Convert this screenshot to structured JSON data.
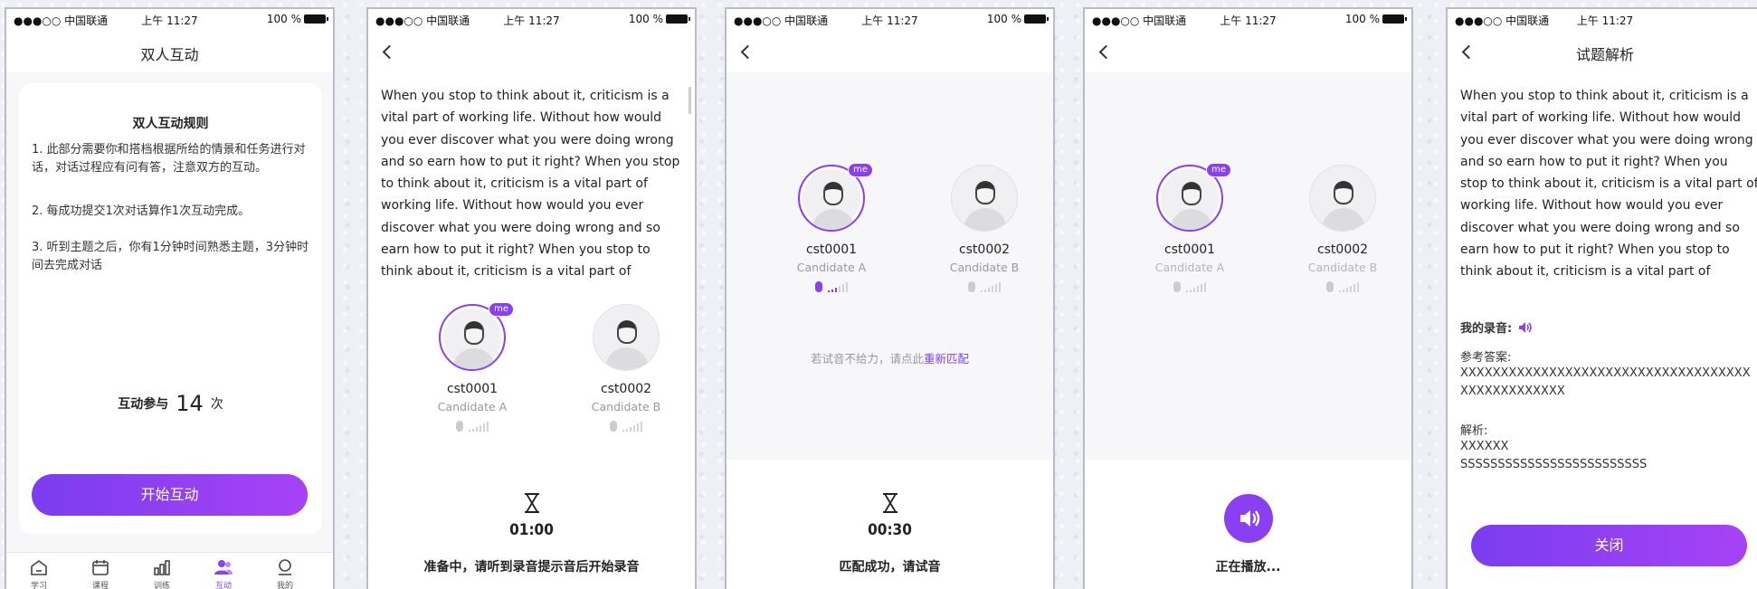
{
  "status_bar": {
    "carrier": "●●●○○ 中国联通",
    "time": "上午 11:27",
    "battery": "100 %"
  },
  "colors": {
    "accent": "#8a3ff2",
    "accent_gradient_end": "#a742f5",
    "muted": "#999999"
  },
  "screen1": {
    "title": "双人互动",
    "rules_title": "双人互动规则",
    "rules": [
      "1. 此部分需要你和搭档根据所给的情景和任务进行对话，对话过程应有问有答，注意双方的互动。",
      "2. 每成功提交1次对话算作1次互动完成。",
      "3. 听到主题之后，你有1分钟时间熟悉主题，3分钟时间去完成对话"
    ],
    "count_label": "互动参与",
    "count_value": "14",
    "count_unit": "次",
    "start_button": "开始互动",
    "tabs": [
      {
        "label": "学习",
        "icon": "home-icon",
        "active": false
      },
      {
        "label": "课程",
        "icon": "calendar-icon",
        "active": false
      },
      {
        "label": "训练",
        "icon": "bar-chart-icon",
        "active": false
      },
      {
        "label": "互动",
        "icon": "users-icon",
        "active": true
      },
      {
        "label": "我的",
        "icon": "profile-icon",
        "active": false
      }
    ]
  },
  "passage": "When you stop to think about it, criticism is a vital part of working life. Without how would you ever discover what you  were doing wrong and so earn how to put it right?  When you stop to think about it, criticism is a vital part of working life. Without how would you ever discover what you  were doing wrong and so earn how to put it right?  When you stop to think about it, criticism is a vital part of",
  "candidates": [
    {
      "id": "cst0001",
      "role": "Candidate A",
      "badge": "me"
    },
    {
      "id": "cst0002",
      "role": "Candidate B",
      "badge": ""
    }
  ],
  "screen2": {
    "timer": "01:00",
    "status": "准备中，请听到录音提示音后开始录音"
  },
  "screen3": {
    "hint_prefix": "若试音不给力，请点此",
    "hint_link": "重新匹配",
    "timer": "00:30",
    "status": "匹配成功，请试音"
  },
  "screen4": {
    "status": "正在播放..."
  },
  "screen5": {
    "title": "试题解析",
    "my_recording_label": "我的录音:",
    "reference_label": "参考答案:",
    "reference_value": "XXXXXXXXXXXXXXXXXXXXXXXXXXXXXXXXXXXXXXXXXXXXXXXXX",
    "analysis_label": "解析:",
    "analysis_line1": "XXXXXX",
    "analysis_line2": "SSSSSSSSSSSSSSSSSSSSSSSSS",
    "close_button": "关闭"
  }
}
